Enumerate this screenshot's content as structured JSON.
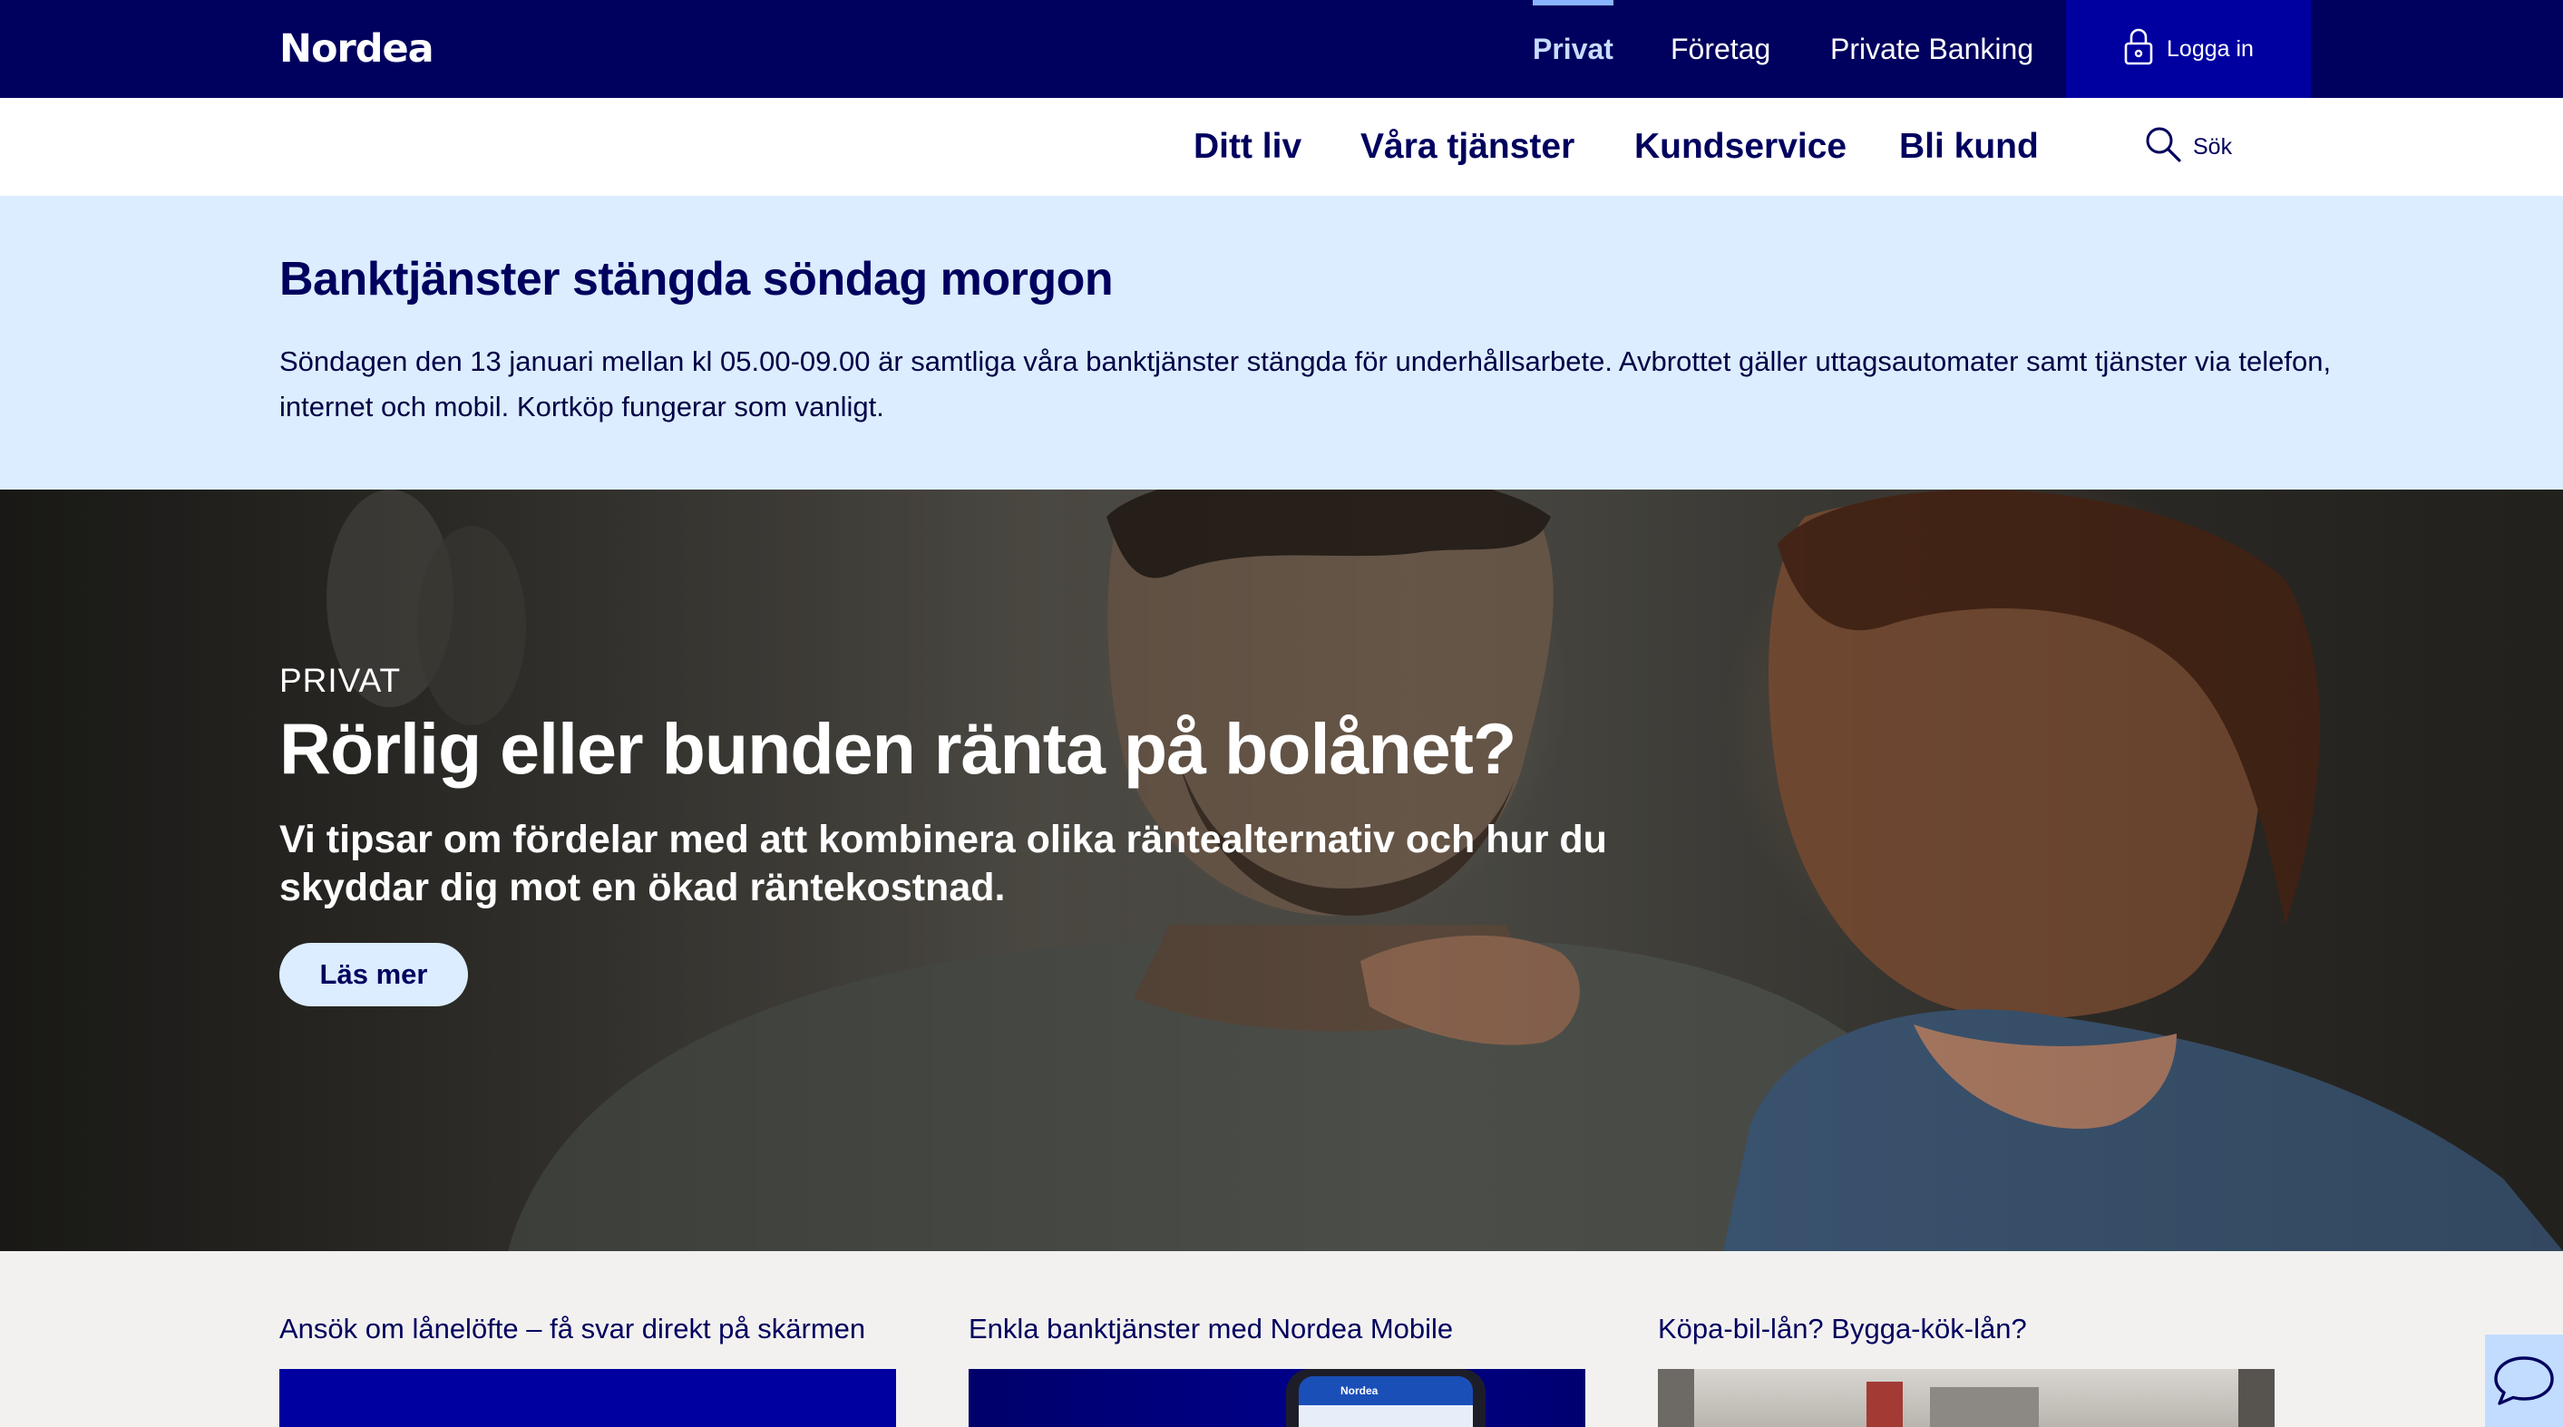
{
  "brand": {
    "logo_text": "Nordea"
  },
  "topnav": {
    "items": [
      {
        "label": "Privat",
        "active": true
      },
      {
        "label": "Företag",
        "active": false
      },
      {
        "label": "Private Banking",
        "active": false
      }
    ],
    "login_label": "Logga in",
    "login_icon": "lock-icon"
  },
  "subnav": {
    "items": [
      {
        "label": "Ditt liv"
      },
      {
        "label": "Våra tjänster"
      },
      {
        "label": "Kundservice"
      },
      {
        "label": "Bli kund"
      }
    ],
    "search_label": "Sök",
    "search_icon": "search-icon"
  },
  "notice": {
    "title": "Banktjänster stängda söndag morgon",
    "body": "Söndagen den 13 januari mellan kl 05.00-09.00 är samtliga våra banktjänster stängda för underhållsarbete. Avbrottet gäller uttagsautomater samt tjänster via telefon, internet och mobil. Kortköp fungerar som vanligt."
  },
  "hero": {
    "eyebrow": "PRIVAT",
    "title": "Rörlig eller bunden ränta på bolånet?",
    "subtitle": "Vi tipsar om fördelar med att kombinera olika räntealternativ och hur du skyddar dig mot en ökad räntekostnad.",
    "button_label": "Läs mer"
  },
  "cards": [
    {
      "title": "Ansök om lånelöfte – få svar direkt på skärmen"
    },
    {
      "title": "Enkla banktjänster med Nordea Mobile",
      "phone_text": "Nordea"
    },
    {
      "title": "Köpa-bil-lån? Bygga-kök-lån?"
    }
  ],
  "chat": {
    "icon": "chat-bubble-icon"
  },
  "colors": {
    "navy": "#00005e",
    "login_blue": "#0000a0",
    "notice_bg": "#dcedff",
    "active_nav": "#c7dcff",
    "card_bg": "#f2f1f0"
  }
}
